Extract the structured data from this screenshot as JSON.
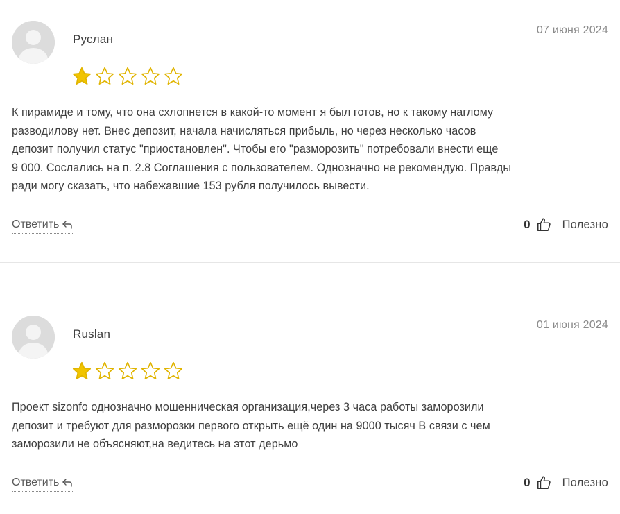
{
  "colors": {
    "star_filled": "#f1c400",
    "star_outline": "#e0b400",
    "avatar_bg": "#dcdcdc",
    "avatar_fg": "#f4f4f4"
  },
  "icons": {
    "avatar": "user-silhouette",
    "reply": "reply-arrow",
    "like": "thumbs-up"
  },
  "reviews": [
    {
      "author": "Руслан",
      "date": "07 июня 2024",
      "rating": 1,
      "max_rating": 5,
      "text_lines": [
        "К пирамиде и тому, что она схлопнется в какой-то момент я был готов, но к такому наглому",
        "разводилову нет. Внес депозит, начала начисляться прибыль, но через несколько часов",
        "депозит получил статус \"приостановлен\". Чтобы его \"разморозить\" потребовали внести еще",
        "9 000. Сослались на п. 2.8 Соглашения с пользователем. Однозначно не рекомендую. Правды",
        "ради могу сказать, что набежавшие 153 рубля получилось вывести."
      ],
      "reply_label": "Ответить",
      "useful_count": "0",
      "useful_label": "Полезно"
    },
    {
      "author": "Ruslan",
      "date": "01 июня 2024",
      "rating": 1,
      "max_rating": 5,
      "text_lines": [
        "Проект sizonfo однозначно мошенническая организация,через 3 часа работы заморозили",
        "депозит и требуют для разморозки первого открыть ещё один на 9000 тысяч В связи с чем",
        "заморозили не объясняют,на ведитесь на этот дерьмо"
      ],
      "reply_label": "Ответить",
      "useful_count": "0",
      "useful_label": "Полезно"
    }
  ]
}
